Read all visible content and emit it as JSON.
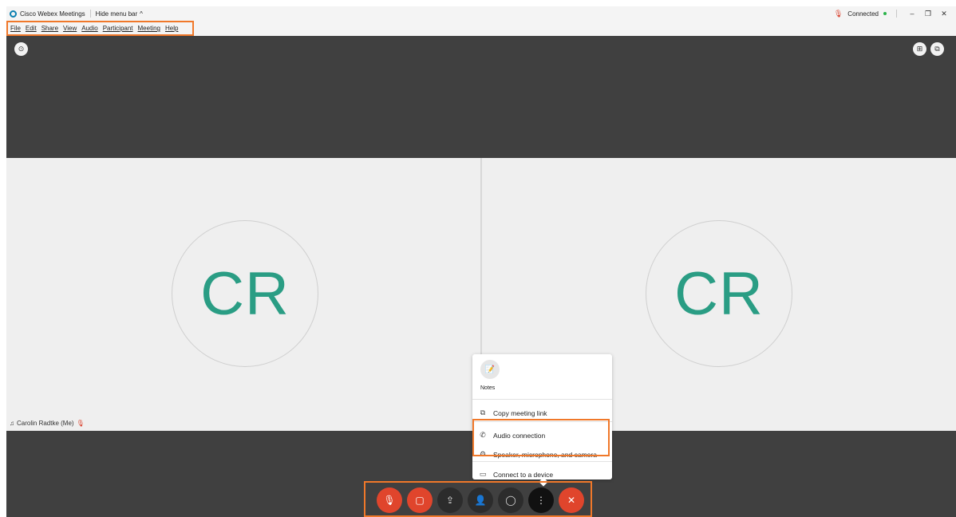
{
  "titlebar": {
    "app_name": "Cisco Webex Meetings",
    "hide_menu": "Hide menu bar",
    "hide_menu_chevron": "^",
    "status": "Connected",
    "minimize": "–",
    "restore": "❐",
    "close": "✕"
  },
  "menu": {
    "items": [
      "File",
      "Edit",
      "Share",
      "View",
      "Audio",
      "Participant",
      "Meeting",
      "Help"
    ]
  },
  "participants": [
    {
      "initials": "CR"
    },
    {
      "initials": "CR"
    }
  ],
  "self_label": "Carolin Radtke (Me)",
  "popup": {
    "notes": "Notes",
    "copy_link": "Copy meeting link",
    "audio_connection": "Audio connection",
    "speaker_mic_camera": "Speaker, microphone, and camera",
    "connect_device": "Connect to a device"
  },
  "controls": {
    "mute": "mic-muted-icon",
    "video": "video-off-icon",
    "share": "share-icon",
    "participants": "participants-icon",
    "chat": "chat-icon",
    "more": "more-icon",
    "leave": "leave-icon"
  },
  "colors": {
    "accent_highlight": "#f0782a",
    "mute_red": "#e0452c",
    "avatar_text": "#2a9d84",
    "stage_dark": "#404040",
    "status_green": "#2bb34a"
  }
}
